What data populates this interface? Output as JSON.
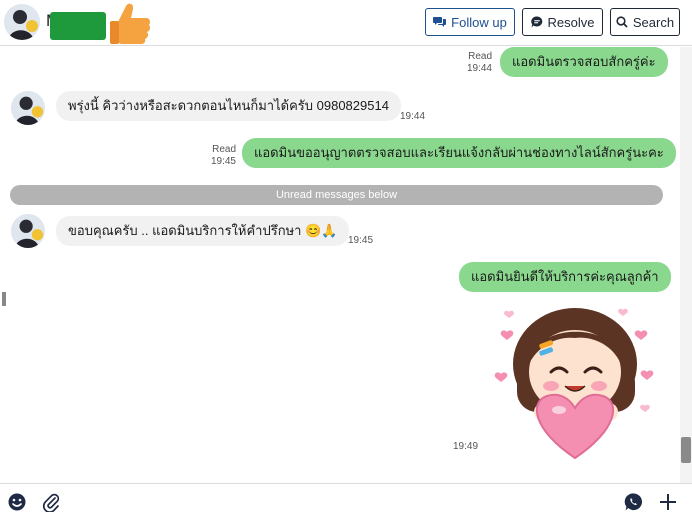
{
  "header": {
    "contact_name": "M",
    "follow_label": "Follow up",
    "resolve_label": "Resolve",
    "search_label": "Search"
  },
  "messages": [
    {
      "direction": "out",
      "text": "แอดมินตรวจสอบสักครู่ค่ะ",
      "status": "Read",
      "time": "19:44"
    },
    {
      "direction": "in",
      "text": "พรุ่งนี้ คิวว่างหรือสะดวกตอนไหนก็มาได้ครับ  0980829514",
      "time": "19:44"
    },
    {
      "direction": "out",
      "text": "แอดมินขออนุญาตตรวจสอบและเรียนแจ้งกลับผ่านช่องทางไลน์สักครู่นะคะ",
      "status": "Read",
      "time": "19:45"
    },
    {
      "direction": "in",
      "text": "ขอบคุณครับ ..  แอดมินบริการให้คำปรึกษา 😊🙏",
      "time": "19:45"
    },
    {
      "direction": "out",
      "text": "แอดมินยินดีให้บริการค่ะคุณลูกค้า"
    },
    {
      "direction": "out",
      "type": "sticker",
      "sticker": "girl-holding-heart-sticker",
      "time": "19:49"
    }
  ],
  "unread_divider": "Unread messages below",
  "colors": {
    "outgoing_bubble": "#8ad88e",
    "incoming_bubble": "#f1f1f1",
    "follow_button": "#1d4f91",
    "censor_block": "#1e9a3c"
  },
  "composer": {
    "icons": [
      "emoji-icon",
      "attachment-icon",
      "whatsapp-icon",
      "plus-icon"
    ]
  }
}
